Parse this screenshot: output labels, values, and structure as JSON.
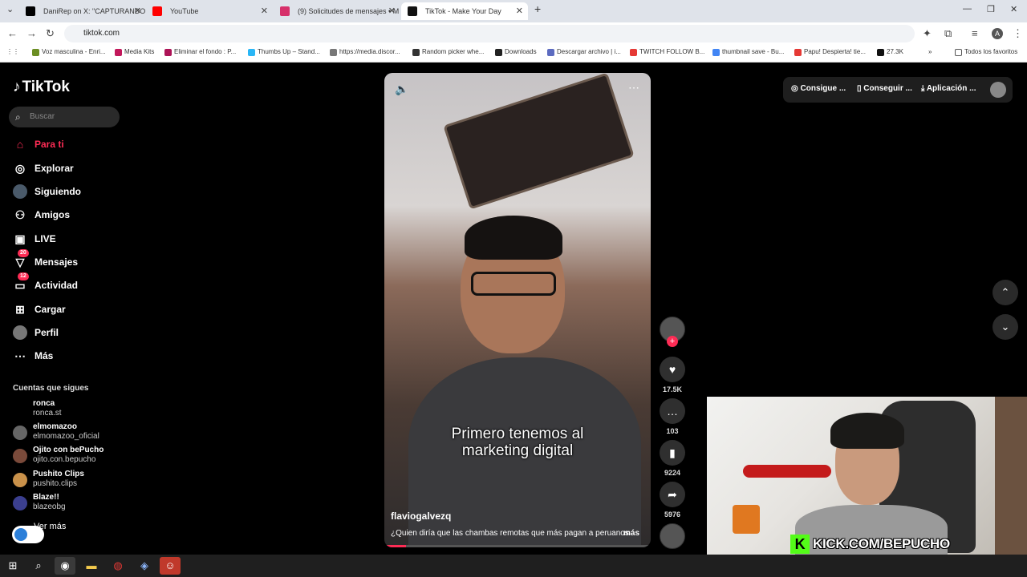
{
  "browser": {
    "tabs": [
      {
        "title": "DaniRep on X: \"CAPTURANDO"
      },
      {
        "title": "YouTube"
      },
      {
        "title": "(9) Solicitudes de mensajes • M"
      },
      {
        "title": "TikTok - Make Your Day"
      }
    ],
    "url": "tiktok.com",
    "bookmarks": [
      "Voz masculina - Enri...",
      "Media Kits",
      "Eliminar el fondo : P...",
      "Thumbs Up – Stand...",
      "https://media.discor...",
      "Random picker whe...",
      "Downloads",
      "Descargar archivo | i...",
      "TWITCH FOLLOW B...",
      "thumbnail save - Bu...",
      "Papu! Despierta! tie...",
      "27.3K"
    ],
    "all_bookmarks": "Todos los favoritos"
  },
  "sidebar": {
    "logo": "TikTok",
    "search_placeholder": "Buscar",
    "nav": [
      {
        "label": "Para ti",
        "icon": "home-icon"
      },
      {
        "label": "Explorar",
        "icon": "compass-icon"
      },
      {
        "label": "Siguiendo",
        "icon": "following-icon"
      },
      {
        "label": "Amigos",
        "icon": "friends-icon"
      },
      {
        "label": "LIVE",
        "icon": "live-icon"
      },
      {
        "label": "Mensajes",
        "icon": "messages-icon",
        "badge": "20"
      },
      {
        "label": "Actividad",
        "icon": "activity-icon",
        "badge": "12"
      },
      {
        "label": "Cargar",
        "icon": "upload-icon"
      },
      {
        "label": "Perfil",
        "icon": "profile-icon"
      },
      {
        "label": "Más",
        "icon": "more-icon"
      }
    ],
    "following_title": "Cuentas que sigues",
    "following": [
      {
        "name": "ronca",
        "handle": "ronca.st"
      },
      {
        "name": "elmomazoo",
        "handle": "elmomazoo_oficial"
      },
      {
        "name": "Ojito con bePucho",
        "handle": "ojito.con.bepucho"
      },
      {
        "name": "Pushito Clips",
        "handle": "pushito.clips"
      },
      {
        "name": "Blaze!!",
        "handle": "blazeobg"
      }
    ],
    "see_more": "Ver más"
  },
  "video": {
    "subtitle_line1": "Primero tenemos al",
    "subtitle_line2": "marketing digital",
    "author": "flaviogalvezq",
    "caption": "¿Quien diría que las chambas remotas que más pagan a peruanos",
    "more": "más",
    "progress": 0.08
  },
  "actions": {
    "likes": "17.5K",
    "comments": "103",
    "saves": "9224",
    "shares": "5976"
  },
  "topbar": {
    "coins": "Consigue ...",
    "app1": "Conseguir ...",
    "app2": "Aplicación ..."
  },
  "overlay": {
    "kick": "KICK.COM/BEPUCHO",
    "kick_letter": "K"
  }
}
